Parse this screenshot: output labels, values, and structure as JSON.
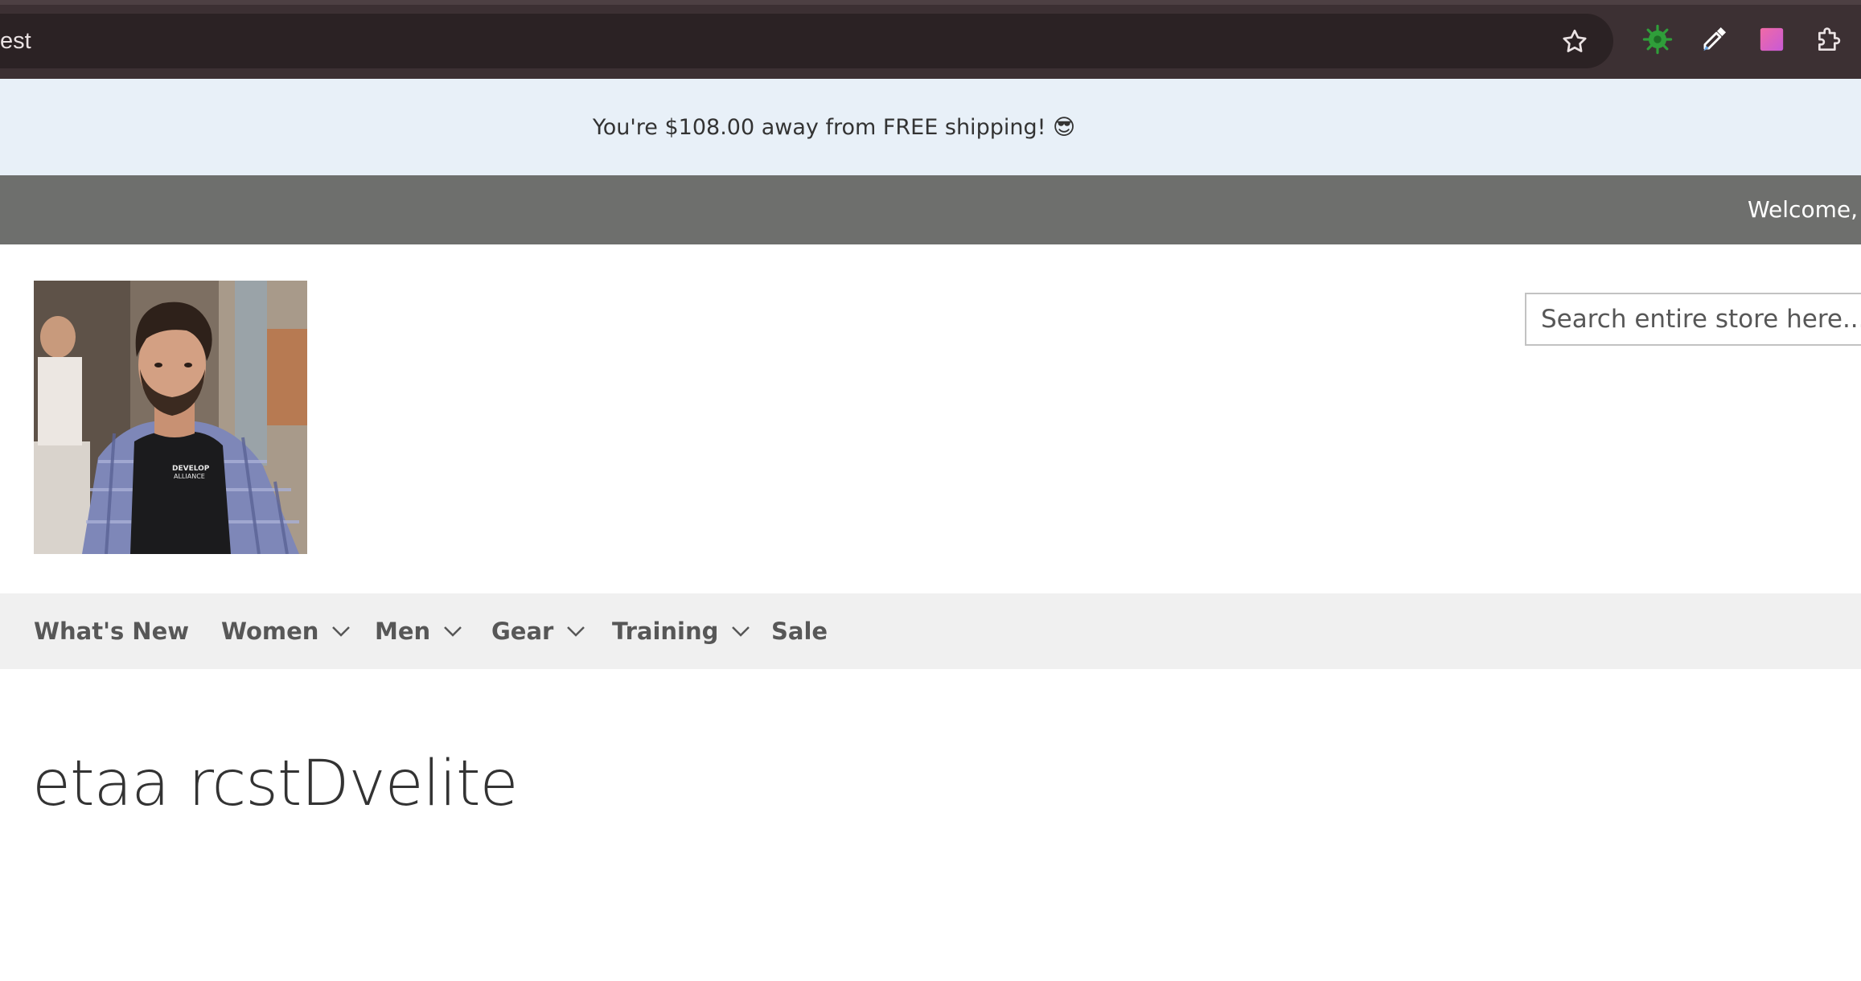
{
  "browser": {
    "omnibox_text": "est",
    "extensions": [
      "bookmark-star-icon",
      "bug-extension-icon",
      "eyedropper-extension-icon",
      "color-gradient-extension-icon",
      "extensions-puzzle-icon"
    ]
  },
  "promo": {
    "text": "You're $108.00 away from FREE shipping! 😎"
  },
  "welcome": {
    "text": "Welcome, g"
  },
  "header": {
    "logo_alt": "store-logo-photo",
    "search_placeholder": "Search entire store here..."
  },
  "nav": {
    "items": [
      {
        "label": "What's New",
        "has_dropdown": false
      },
      {
        "label": "Women",
        "has_dropdown": true
      },
      {
        "label": "Men",
        "has_dropdown": true
      },
      {
        "label": "Gear",
        "has_dropdown": true
      },
      {
        "label": "Training",
        "has_dropdown": true
      },
      {
        "label": "Sale",
        "has_dropdown": false
      }
    ]
  },
  "page": {
    "title": "etaa rcstDvelite"
  },
  "colors": {
    "chrome_bg": "#3c3033",
    "omnibox_bg": "#2b2224",
    "promo_bg": "#e8f0f8",
    "welcome_bar_bg": "#6e6f6d",
    "nav_bg": "#f0f0f0",
    "nav_text": "#575757"
  }
}
